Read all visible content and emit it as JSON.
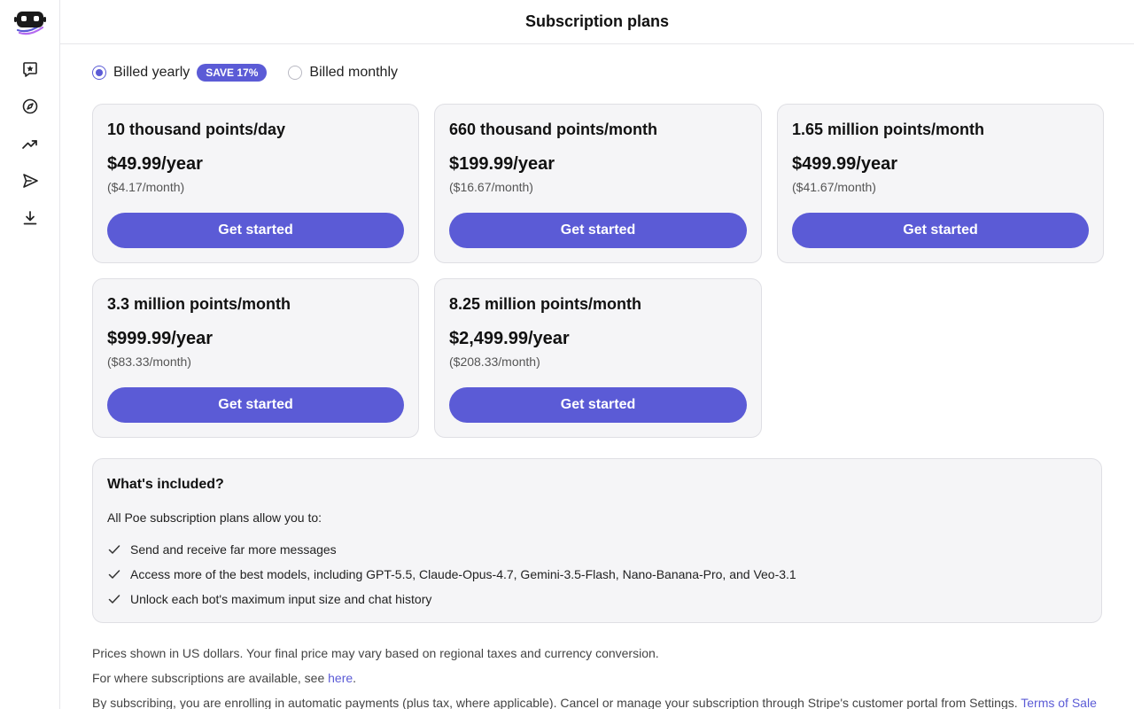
{
  "header": {
    "title": "Subscription plans"
  },
  "sidebar": {
    "items": [
      {
        "icon": "chat-star-icon"
      },
      {
        "icon": "compass-icon"
      },
      {
        "icon": "trending-up-icon"
      },
      {
        "icon": "send-icon"
      },
      {
        "icon": "download-icon"
      }
    ]
  },
  "billing": {
    "yearly_label": "Billed yearly",
    "save_badge": "SAVE 17%",
    "monthly_label": "Billed monthly",
    "selected": "yearly"
  },
  "plans": [
    {
      "title": "10 thousand points/day",
      "price": "$49.99/year",
      "monthly": "($4.17/month)",
      "cta": "Get started"
    },
    {
      "title": "660 thousand points/month",
      "price": "$199.99/year",
      "monthly": "($16.67/month)",
      "cta": "Get started"
    },
    {
      "title": "1.65 million points/month",
      "price": "$499.99/year",
      "monthly": "($41.67/month)",
      "cta": "Get started"
    },
    {
      "title": "3.3 million points/month",
      "price": "$999.99/year",
      "monthly": "($83.33/month)",
      "cta": "Get started"
    },
    {
      "title": "8.25 million points/month",
      "price": "$2,499.99/year",
      "monthly": "($208.33/month)",
      "cta": "Get started"
    }
  ],
  "included": {
    "title": "What's included?",
    "intro": "All Poe subscription plans allow you to:",
    "items": [
      "Send and receive far more messages",
      "Access more of the best models, including GPT-5.5, Claude-Opus-4.7, Gemini-3.5-Flash, Nano-Banana-Pro, and Veo-3.1",
      "Unlock each bot's maximum input size and chat history"
    ]
  },
  "notes": {
    "currency": "Prices shown in US dollars. Your final price may vary based on regional taxes and currency conversion.",
    "availability_prefix": "For where subscriptions are available, see ",
    "availability_link": "here",
    "availability_suffix": ".",
    "autopay": "By subscribing, you are enrolling in automatic payments (plus tax, where applicable). Cancel or manage your subscription through Stripe's customer portal from Settings. ",
    "terms_link": "Terms of Sale"
  },
  "colors": {
    "accent": "#5b5bd6",
    "card_bg": "#f5f5f7",
    "border": "#dfdfe4"
  }
}
